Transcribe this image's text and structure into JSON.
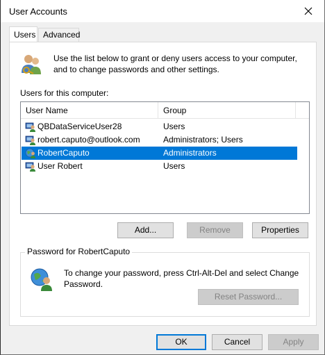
{
  "window": {
    "title": "User Accounts",
    "close_icon": "close-icon"
  },
  "tabs": [
    {
      "label": "Users",
      "active": true
    },
    {
      "label": "Advanced",
      "active": false
    }
  ],
  "intro": {
    "text": "Use the list below to grant or deny users access to your computer, and to change passwords and other settings.",
    "icon": "users-keys-icon"
  },
  "users_label": "Users for this computer:",
  "list": {
    "columns": [
      "User Name",
      "Group"
    ],
    "rows": [
      {
        "name": "QBDataServiceUser28",
        "group": "Users",
        "icon": "user-account-icon",
        "selected": false
      },
      {
        "name": "robert.caputo@outlook.com",
        "group": "Administrators; Users",
        "icon": "user-account-icon",
        "selected": false
      },
      {
        "name": "RobertCaputo",
        "group": "Administrators",
        "icon": "globe-user-icon",
        "selected": true
      },
      {
        "name": "User Robert",
        "group": "Users",
        "icon": "user-account-icon",
        "selected": false
      }
    ]
  },
  "buttons": {
    "add": "Add...",
    "remove": "Remove",
    "properties": "Properties",
    "reset_password": "Reset Password...",
    "ok": "OK",
    "cancel": "Cancel",
    "apply": "Apply"
  },
  "password": {
    "title": "Password for RobertCaputo",
    "text": "To change your password, press Ctrl-Alt-Del and select Change Password.",
    "icon": "globe-user-icon"
  },
  "colors": {
    "selection": "#0078d7",
    "window_bg": "#f0f0f0"
  }
}
